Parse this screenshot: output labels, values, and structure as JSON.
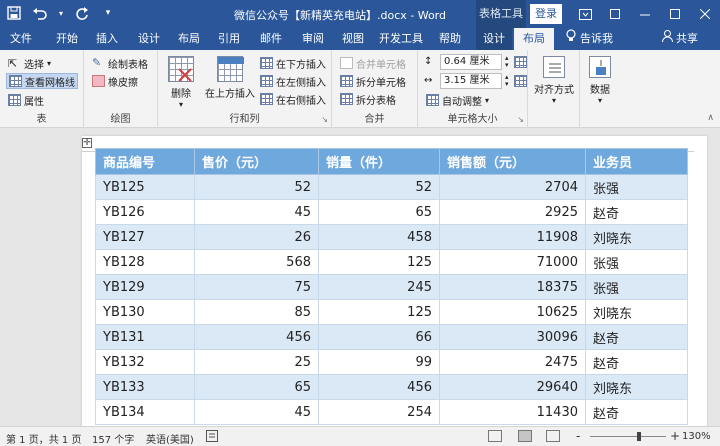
{
  "window": {
    "title": "微信公众号【新精英充电站】.docx - Word",
    "context_tab_group": "表格工具",
    "login_label": "登录"
  },
  "qat": {
    "save_icon": "save-icon",
    "undo_icon": "undo-icon",
    "redo_icon": "redo-icon",
    "customize_icon": "customize-icon"
  },
  "tabs": [
    "文件",
    "开始",
    "插入",
    "设计",
    "布局",
    "引用",
    "邮件",
    "审阅",
    "视图",
    "开发工具",
    "帮助",
    "设计",
    "布局"
  ],
  "tell_me": "告诉我",
  "share": "共享",
  "ribbon": {
    "table_group": {
      "name": "表",
      "select": "选择",
      "gridlines": "查看网格线",
      "properties": "属性"
    },
    "draw_group": {
      "name": "绘图",
      "draw_table": "绘制表格",
      "eraser": "橡皮擦"
    },
    "rows_cols_group": {
      "name": "行和列",
      "delete": "删除",
      "insert_above": "在上方插入",
      "insert_below": "在下方插入",
      "insert_left": "在左侧插入",
      "insert_right": "在右侧插入"
    },
    "merge_group": {
      "name": "合并",
      "merge_cells": "合并单元格",
      "split_cells": "拆分单元格",
      "split_table": "拆分表格"
    },
    "cell_size_group": {
      "name": "单元格大小",
      "height": "0.64 厘米",
      "width": "3.15 厘米",
      "autofit": "自动调整"
    },
    "alignment": "对齐方式",
    "data": "数据"
  },
  "table": {
    "headers": [
      "商品编号",
      "售价（元）",
      "销量（件）",
      "销售额（元）",
      "业务员"
    ],
    "rows": [
      [
        "YB125",
        "52",
        "52",
        "2704",
        "张强"
      ],
      [
        "YB126",
        "45",
        "65",
        "2925",
        "赵奇"
      ],
      [
        "YB127",
        "26",
        "458",
        "11908",
        "刘晓东"
      ],
      [
        "YB128",
        "568",
        "125",
        "71000",
        "张强"
      ],
      [
        "YB129",
        "75",
        "245",
        "18375",
        "张强"
      ],
      [
        "YB130",
        "85",
        "125",
        "10625",
        "刘晓东"
      ],
      [
        "YB131",
        "456",
        "66",
        "30096",
        "赵奇"
      ],
      [
        "YB132",
        "25",
        "99",
        "2475",
        "赵奇"
      ],
      [
        "YB133",
        "65",
        "456",
        "29640",
        "刘晓东"
      ],
      [
        "YB134",
        "45",
        "254",
        "11430",
        "赵奇"
      ]
    ]
  },
  "status": {
    "page": "第 1 页，共 1 页",
    "words": "157 个字",
    "language": "英语(美国)",
    "zoom_minus": "-",
    "zoom_plus": "+",
    "zoom": "130%",
    "zoom_level_fraction": 0.65
  },
  "colors": {
    "titlebar": "#2b579a",
    "header_fill": "#6fa8dc",
    "band_fill": "#dbe8f6"
  }
}
